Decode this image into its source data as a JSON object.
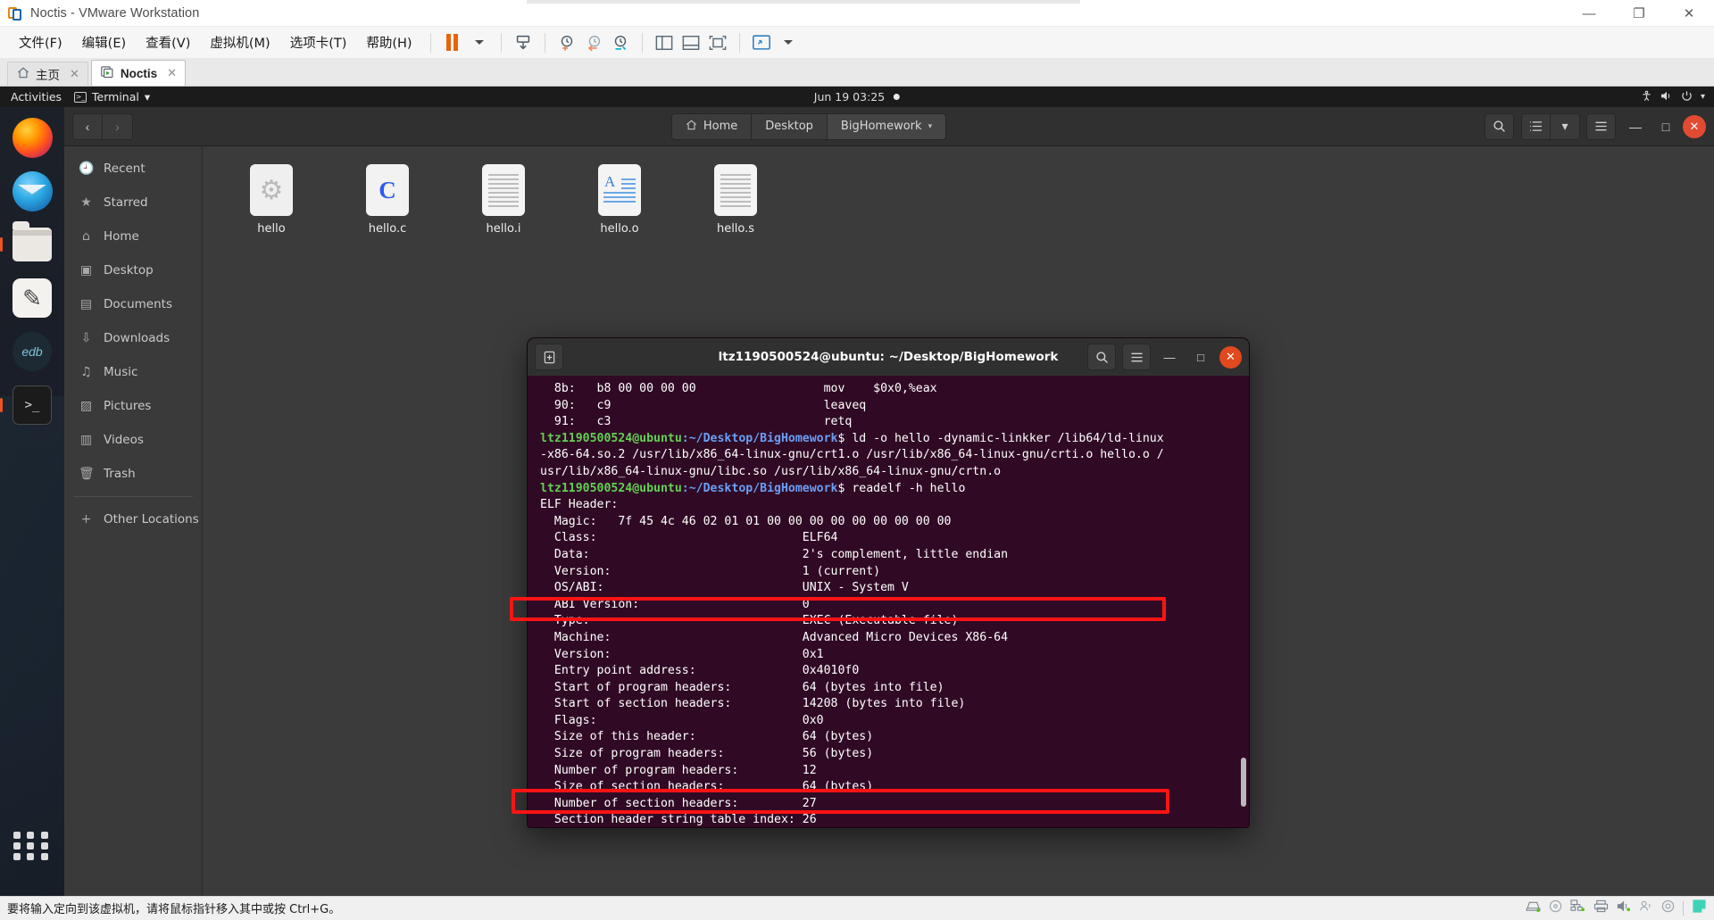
{
  "vmware": {
    "title": "Noctis - VMware Workstation",
    "window_buttons": [
      {
        "name": "minimize",
        "glyph": "—"
      },
      {
        "name": "maximize",
        "glyph": "❐"
      },
      {
        "name": "close",
        "glyph": "✕"
      }
    ],
    "menus": [
      {
        "label": "文件(F)"
      },
      {
        "label": "编辑(E)"
      },
      {
        "label": "查看(V)"
      },
      {
        "label": "虚拟机(M)"
      },
      {
        "label": "选项卡(T)"
      },
      {
        "label": "帮助(H)"
      }
    ],
    "toolbar_icons": [
      "pause-icon",
      "dropdown-caret-icon",
      "send-ctrl-alt-del-icon",
      "snapshot-take-icon",
      "snapshot-revert-icon",
      "snapshot-manager-icon",
      "show-sidebar-icon",
      "show-bottom-panel-icon",
      "show-console-icon",
      "unity-mode-icon",
      "fullscreen-icon",
      "fullscreen-caret-icon"
    ],
    "tabs": [
      {
        "label": "主页",
        "icon": "home-icon",
        "close": "✕",
        "active": false
      },
      {
        "label": "Noctis",
        "icon": "vm-running-icon",
        "close": "✕",
        "active": true
      }
    ],
    "statusbar": {
      "message": "要将输入定向到该虚拟机，请将鼠标指针移入其中或按 Ctrl+G。",
      "device_icons": [
        "harddisk-icon",
        "cdrom-icon",
        "network-icon",
        "printer-icon",
        "sound-icon",
        "usb-icon",
        "camera-icon",
        "separator",
        "notes-icon"
      ]
    }
  },
  "gnome": {
    "topbar": {
      "activities": "Activities",
      "app_name": "Terminal",
      "app_icon": "terminal-icon",
      "app_caret": "▾",
      "clock": "Jun 19  03:25",
      "status_icons": [
        "accessibility-icon",
        "volume-icon",
        "power-icon",
        "chevron-down-icon"
      ]
    },
    "dock": [
      {
        "name": "firefox",
        "icon": "firefox-icon",
        "active": false
      },
      {
        "name": "thunderbird",
        "icon": "thunderbird-icon",
        "active": false
      },
      {
        "name": "files",
        "icon": "files-icon",
        "active": true
      },
      {
        "name": "text-editor",
        "icon": "text-editor-icon",
        "active": false
      },
      {
        "name": "edb-debugger",
        "icon": "edb-icon",
        "active": false
      },
      {
        "name": "terminal",
        "icon": "terminal-icon",
        "active": true
      }
    ],
    "dock_bottom": {
      "name": "show-applications",
      "icon": "grid-apps-icon"
    }
  },
  "nautilus": {
    "nav": {
      "back": "‹",
      "forward": "›"
    },
    "breadcrumb": [
      {
        "label": "Home",
        "icon": "home-icon",
        "current": false
      },
      {
        "label": "Desktop",
        "icon": "",
        "current": false
      },
      {
        "label": "BigHomework",
        "icon": "",
        "current": true,
        "caret": "▾"
      }
    ],
    "header_buttons": [
      {
        "name": "search-button",
        "glyph": "⌕"
      },
      {
        "name": "list-view-button",
        "glyph": "☰"
      },
      {
        "name": "view-options-caret",
        "glyph": "▾"
      },
      {
        "name": "main-menu-button",
        "glyph": "☰"
      }
    ],
    "window_controls": [
      {
        "name": "minimize",
        "glyph": "—"
      },
      {
        "name": "maximize",
        "glyph": "□"
      },
      {
        "name": "close",
        "glyph": "✕"
      }
    ],
    "sidebar": [
      {
        "label": "Recent",
        "icon": "clock-icon"
      },
      {
        "label": "Starred",
        "icon": "star-icon"
      },
      {
        "label": "Home",
        "icon": "home-icon"
      },
      {
        "label": "Desktop",
        "icon": "desktop-icon"
      },
      {
        "label": "Documents",
        "icon": "documents-icon"
      },
      {
        "label": "Downloads",
        "icon": "download-icon"
      },
      {
        "label": "Music",
        "icon": "music-icon"
      },
      {
        "label": "Pictures",
        "icon": "pictures-icon"
      },
      {
        "label": "Videos",
        "icon": "videos-icon"
      },
      {
        "label": "Trash",
        "icon": "trash-icon"
      }
    ],
    "sidebar_other": {
      "label": "Other Locations",
      "icon": "plus-icon"
    },
    "files": [
      {
        "name": "hello",
        "icon": "executable-gear-icon"
      },
      {
        "name": "hello.c",
        "icon": "c-source-icon"
      },
      {
        "name": "hello.i",
        "icon": "text-lines-icon"
      },
      {
        "name": "hello.o",
        "icon": "object-file-icon"
      },
      {
        "name": "hello.s",
        "icon": "text-lines-icon"
      }
    ]
  },
  "terminal": {
    "title": "ltz1190500524@ubuntu: ~/Desktop/BigHomework",
    "header_buttons": [
      {
        "name": "new-tab-button",
        "glyph": "⊞"
      },
      {
        "name": "search-button",
        "glyph": "⌕"
      },
      {
        "name": "menu-button",
        "glyph": "☰"
      }
    ],
    "window_controls": [
      {
        "name": "minimize",
        "glyph": "—"
      },
      {
        "name": "maximize",
        "glyph": "□"
      },
      {
        "name": "close",
        "glyph": "✕"
      }
    ],
    "prompt_user": "ltz1190500524@ubuntu",
    "prompt_path": ":~/Desktop/BigHomework",
    "lines": [
      {
        "type": "plain",
        "text": "  8b:\tb8 00 00 00 00          \tmov    $0x0,%eax"
      },
      {
        "type": "plain",
        "text": "  90:\tc9                      \tleaveq "
      },
      {
        "type": "plain",
        "text": "  91:\tc3                      \tretq   "
      },
      {
        "type": "prompt",
        "command": "$ ld -o hello -dynamic-linkker /lib64/ld-linux"
      },
      {
        "type": "plain",
        "text": "-x86-64.so.2 /usr/lib/x86_64-linux-gnu/crt1.o /usr/lib/x86_64-linux-gnu/crti.o hello.o /"
      },
      {
        "type": "plain",
        "text": "usr/lib/x86_64-linux-gnu/libc.so /usr/lib/x86_64-linux-gnu/crtn.o"
      },
      {
        "type": "prompt",
        "command": "$ readelf -h hello"
      },
      {
        "type": "plain",
        "text": "ELF Header:"
      },
      {
        "type": "plain",
        "text": "  Magic:   7f 45 4c 46 02 01 01 00 00 00 00 00 00 00 00 00"
      },
      {
        "type": "plain",
        "text": "  Class:                             ELF64"
      },
      {
        "type": "plain",
        "text": "  Data:                              2's complement, little endian"
      },
      {
        "type": "plain",
        "text": "  Version:                           1 (current)"
      },
      {
        "type": "plain",
        "text": "  OS/ABI:                            UNIX - System V"
      },
      {
        "type": "plain",
        "text": "  ABI Version:                       0"
      },
      {
        "type": "plain",
        "text": "  Type:                              EXEC (Executable file)"
      },
      {
        "type": "plain",
        "text": "  Machine:                           Advanced Micro Devices X86-64"
      },
      {
        "type": "plain",
        "text": "  Version:                           0x1"
      },
      {
        "type": "plain",
        "text": "  Entry point address:               0x4010f0"
      },
      {
        "type": "plain",
        "text": "  Start of program headers:          64 (bytes into file)"
      },
      {
        "type": "plain",
        "text": "  Start of section headers:          14208 (bytes into file)"
      },
      {
        "type": "plain",
        "text": "  Flags:                             0x0"
      },
      {
        "type": "plain",
        "text": "  Size of this header:               64 (bytes)"
      },
      {
        "type": "plain",
        "text": "  Size of program headers:           56 (bytes)"
      },
      {
        "type": "plain",
        "text": "  Number of program headers:         12"
      },
      {
        "type": "plain",
        "text": "  Size of section headers:           64 (bytes)"
      },
      {
        "type": "plain",
        "text": "  Number of section headers:         27"
      },
      {
        "type": "plain",
        "text": "  Section header string table index: 26"
      },
      {
        "type": "prompt",
        "command": "$ "
      }
    ],
    "highlights": [
      {
        "name": "type-row-highlight",
        "color": "#fc1414"
      },
      {
        "name": "section-header-string-table-highlight",
        "color": "#fc1414"
      }
    ]
  }
}
